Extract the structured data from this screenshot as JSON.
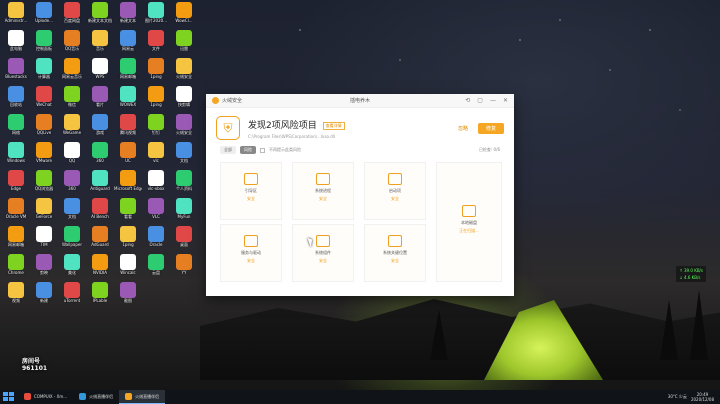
{
  "window": {
    "app_name": "火绒安全",
    "title": "插电养木",
    "controls": [
      "⟲",
      "▢",
      "—",
      "✕"
    ],
    "header": {
      "title": "发现2项风险项目",
      "tag": "查看详情",
      "path": "C:\\Program Files\\WPS\\Corporation\\...\\kso.dll",
      "ghost_button": "忽略",
      "main_button": "修复"
    },
    "filters": [
      "全部",
      "风险"
    ],
    "checkbox_label": "不再提示此类风险",
    "right_info": "已检查: 0/6",
    "cards": [
      {
        "name": "引导区",
        "status": "安全"
      },
      {
        "name": "系统进程",
        "status": "安全"
      },
      {
        "name": "启动项",
        "status": "安全"
      },
      {
        "name": "服务与驱动",
        "status": "安全"
      },
      {
        "name": "系统组件",
        "status": "安全"
      },
      {
        "name": "系统关键位置",
        "status": "安全"
      },
      {
        "name": "本地磁盘",
        "status": "正在扫描..."
      }
    ]
  },
  "desktop_icons": [
    {
      "label": "Administr..."
    },
    {
      "label": "Uplode..."
    },
    {
      "label": "百度网盘"
    },
    {
      "label": "新建文本文档"
    },
    {
      "label": "新建文本"
    },
    {
      "label": "图片2020..."
    },
    {
      "label": "WowCl..."
    },
    {
      "label": "此电脑"
    },
    {
      "label": "控制面板"
    },
    {
      "label": "QQ音乐"
    },
    {
      "label": "音乐"
    },
    {
      "label": "网易云"
    },
    {
      "label": "文件"
    },
    {
      "label": "迅雷"
    },
    {
      "label": "Bluestacks"
    },
    {
      "label": "计算器"
    },
    {
      "label": "网易云音乐"
    },
    {
      "label": "WPS"
    },
    {
      "label": "网易邮箱"
    },
    {
      "label": "1ping"
    },
    {
      "label": "火绒安全"
    },
    {
      "label": "回收站"
    },
    {
      "label": "WeChat"
    },
    {
      "label": "微信"
    },
    {
      "label": "看片"
    },
    {
      "label": "WOWEX"
    },
    {
      "label": "1ping"
    },
    {
      "label": "快剪辑"
    },
    {
      "label": "网络"
    },
    {
      "label": "QQLive"
    },
    {
      "label": "WeGame"
    },
    {
      "label": "游戏"
    },
    {
      "label": "腾讯视频"
    },
    {
      "label": "钉钉"
    },
    {
      "label": "火绒安全"
    },
    {
      "label": "Windows"
    },
    {
      "label": "VMware"
    },
    {
      "label": "QQ"
    },
    {
      "label": "360"
    },
    {
      "label": "UC"
    },
    {
      "label": "vlc"
    },
    {
      "label": "文档"
    },
    {
      "label": "Edge"
    },
    {
      "label": "QQ浏览器"
    },
    {
      "label": "360"
    },
    {
      "label": "Antiguard"
    },
    {
      "label": "Microsoft Edge"
    },
    {
      "label": "vlc-xbox"
    },
    {
      "label": "个人资料"
    },
    {
      "label": "Oracle VM"
    },
    {
      "label": "GeForce"
    },
    {
      "label": "文档"
    },
    {
      "label": "AI Bench"
    },
    {
      "label": "看看"
    },
    {
      "label": "VLC"
    },
    {
      "label": "MyFun"
    },
    {
      "label": "网易邮箱"
    },
    {
      "label": "TIM"
    },
    {
      "label": "Wallpaper"
    },
    {
      "label": "AdGuard"
    },
    {
      "label": "1ping"
    },
    {
      "label": "Oracle"
    },
    {
      "label": "桌面"
    },
    {
      "label": "Chrome"
    },
    {
      "label": "剪映"
    },
    {
      "label": "美化"
    },
    {
      "label": "NVIDIA"
    },
    {
      "label": "Wincalc"
    },
    {
      "label": "云盘"
    },
    {
      "label": "YY"
    },
    {
      "label": "视频"
    },
    {
      "label": "新建"
    },
    {
      "label": "uTorrent"
    },
    {
      "label": "IPLable"
    },
    {
      "label": "截图"
    }
  ],
  "watermark": {
    "line1": "房间号",
    "line2": "961101"
  },
  "net_speed": {
    "up": "↑ 39.0 KB/s",
    "down": "↓ 4.6 KB/s"
  },
  "taskbar": {
    "items": [
      {
        "label": "COMPUIX - Xm...",
        "active": false
      },
      {
        "label": "火绒直播伴侣",
        "active": false
      },
      {
        "label": "火绒直播伴侣",
        "active": true
      }
    ],
    "weather": "30°C 少云",
    "time": "20:49",
    "date": "2020/12/08"
  }
}
